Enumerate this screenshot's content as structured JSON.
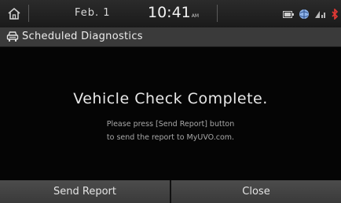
{
  "status": {
    "date": "Feb. 1",
    "time": "10:41",
    "ampm": "AM",
    "icons": [
      "home-icon",
      "battery-icon",
      "globe-icon",
      "signal-icon",
      "bluetooth-icon"
    ]
  },
  "title": {
    "text": "Scheduled Diagnostics",
    "icon": "car-icon"
  },
  "main": {
    "headline": "Vehicle Check Complete.",
    "message_line1": "Please press [Send Report] button",
    "message_line2": "to send the report to MyUVO.com."
  },
  "buttons": {
    "send_label": "Send Report",
    "close_label": "Close"
  },
  "colors": {
    "accent_red": "#d32f2f",
    "bar_gray": "#3a3a3a"
  }
}
